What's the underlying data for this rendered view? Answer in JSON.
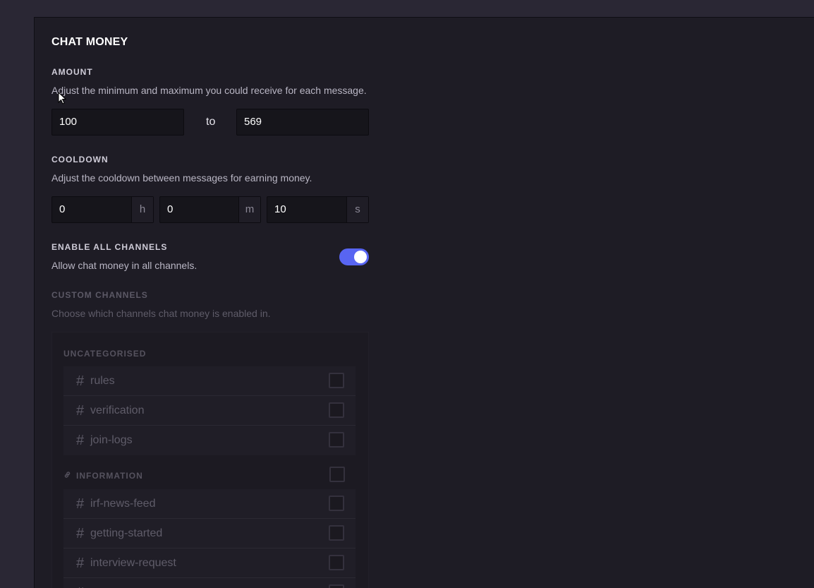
{
  "section": {
    "title": "CHAT MONEY"
  },
  "amount": {
    "label": "AMOUNT",
    "description": "Adjust the minimum and maximum you could receive for each message.",
    "min_value": "100",
    "separator": "to",
    "max_value": "569"
  },
  "cooldown": {
    "label": "COOLDOWN",
    "description": "Adjust the cooldown between messages for earning money.",
    "hours_value": "0",
    "hours_unit": "h",
    "minutes_value": "0",
    "minutes_unit": "m",
    "seconds_value": "10",
    "seconds_unit": "s"
  },
  "enable_all": {
    "label": "ENABLE ALL CHANNELS",
    "description": "Allow chat money in all channels.",
    "enabled": true
  },
  "custom_channels": {
    "label": "CUSTOM CHANNELS",
    "description": "Choose which channels chat money is enabled in.",
    "categories": [
      {
        "name": "UNCATEGORISED",
        "channels": [
          {
            "name": "rules"
          },
          {
            "name": "verification"
          },
          {
            "name": "join-logs"
          }
        ]
      },
      {
        "name": "INFORMATION",
        "icon": "link-icon",
        "channels": [
          {
            "name": "irf-news-feed"
          },
          {
            "name": "getting-started"
          },
          {
            "name": "interview-request"
          }
        ]
      }
    ]
  },
  "colors": {
    "accent": "#5865f2",
    "page_bg": "#2a2734",
    "panel_bg": "#1e1c25"
  }
}
